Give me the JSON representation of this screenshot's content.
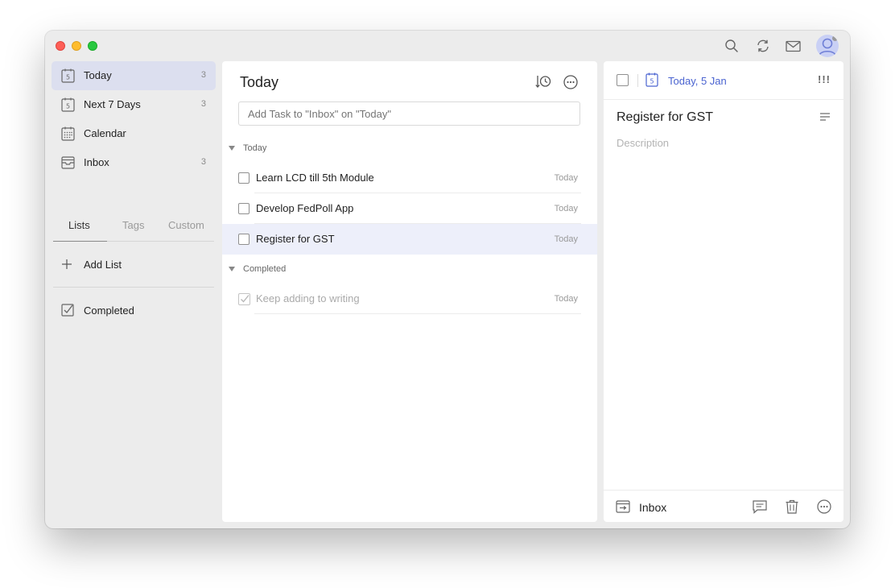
{
  "sidebar": {
    "items": [
      {
        "label": "Today",
        "count": "3",
        "icon": "calendar-day-icon",
        "day": "5"
      },
      {
        "label": "Next 7 Days",
        "count": "3",
        "icon": "calendar-week-icon",
        "day": "5"
      },
      {
        "label": "Calendar",
        "count": "",
        "icon": "calendar-grid-icon"
      },
      {
        "label": "Inbox",
        "count": "3",
        "icon": "inbox-icon"
      }
    ],
    "tabs": [
      "Lists",
      "Tags",
      "Custom"
    ],
    "add_list_label": "Add List",
    "completed_label": "Completed"
  },
  "main": {
    "title": "Today",
    "add_task_placeholder": "Add Task to \"Inbox\" on \"Today\"",
    "sections": [
      {
        "name": "Today",
        "tasks": [
          {
            "title": "Learn LCD till 5th Module",
            "date": "Today",
            "done": false
          },
          {
            "title": "Develop FedPoll App",
            "date": "Today",
            "done": false
          },
          {
            "title": "Register for GST",
            "date": "Today",
            "done": false,
            "selected": true
          }
        ]
      },
      {
        "name": "Completed",
        "tasks": [
          {
            "title": "Keep adding to writing",
            "date": "Today",
            "done": true
          }
        ]
      }
    ]
  },
  "detail": {
    "due_date": "Today, 5 Jan",
    "date_day": "5",
    "priority": "!!!",
    "title": "Register for GST",
    "description_placeholder": "Description",
    "list_name": "Inbox"
  },
  "colors": {
    "accent": "#4a63d0",
    "selected_nav": "#dcdfef",
    "selected_task": "#edeffa",
    "window_bg": "#ececec"
  }
}
